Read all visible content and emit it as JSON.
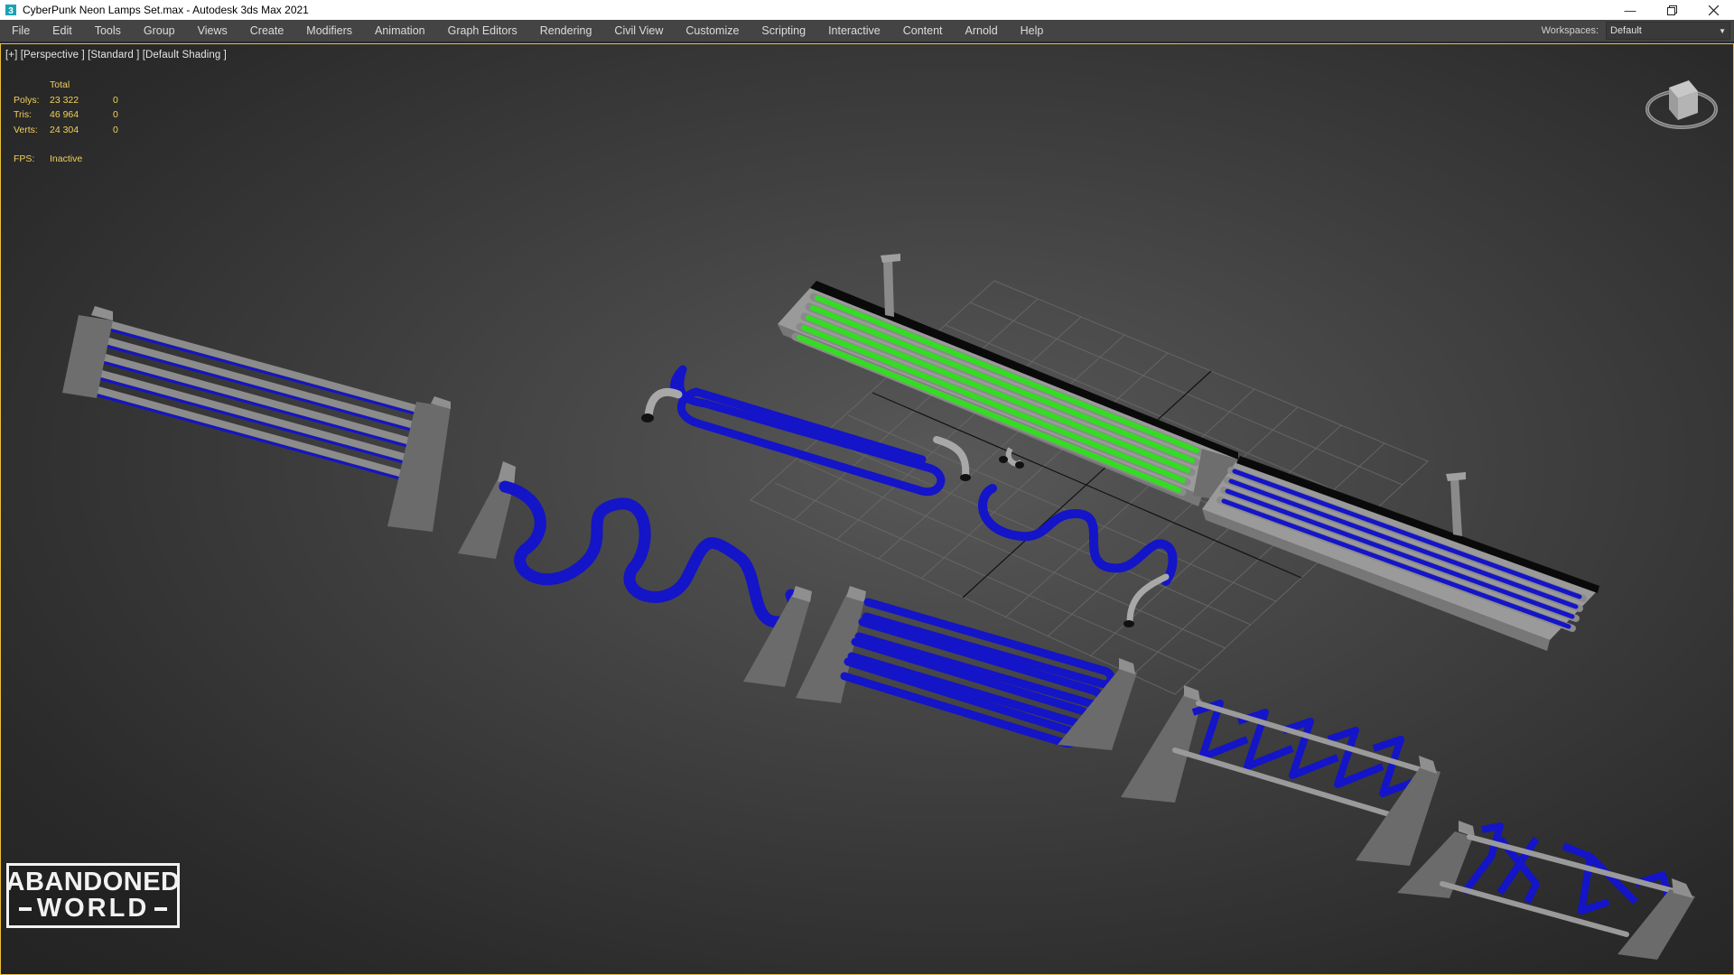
{
  "window": {
    "title": "CyberPunk Neon Lamps Set.max - Autodesk 3ds Max 2021",
    "controls": [
      "minimize-icon",
      "restore-icon",
      "close-icon"
    ]
  },
  "menu": {
    "items": [
      "File",
      "Edit",
      "Tools",
      "Group",
      "Views",
      "Create",
      "Modifiers",
      "Animation",
      "Graph Editors",
      "Rendering",
      "Civil View",
      "Customize",
      "Scripting",
      "Interactive",
      "Content",
      "Arnold",
      "Help"
    ],
    "workspaces_label": "Workspaces:",
    "workspaces_value": "Default"
  },
  "viewport": {
    "label": "[+] [Perspective ] [Standard ] [Default Shading ]",
    "stats": {
      "header": "Total",
      "rows": [
        {
          "key": "Polys:",
          "total": "23 322",
          "selected": "0"
        },
        {
          "key": "Tris:",
          "total": "46 964",
          "selected": "0"
        },
        {
          "key": "Verts:",
          "total": "24 304",
          "selected": "0"
        }
      ],
      "fps_key": "FPS:",
      "fps_value": "Inactive"
    }
  },
  "watermark": {
    "line1": "ABANDONED",
    "line2": "WORLD"
  },
  "colors": {
    "neon_blue": "#1414c8",
    "neon_green": "#33dd22",
    "metal_gray": "#8a8a8a",
    "stats_yellow": "#f1d15a",
    "viewport_border": "#e8c23a"
  }
}
